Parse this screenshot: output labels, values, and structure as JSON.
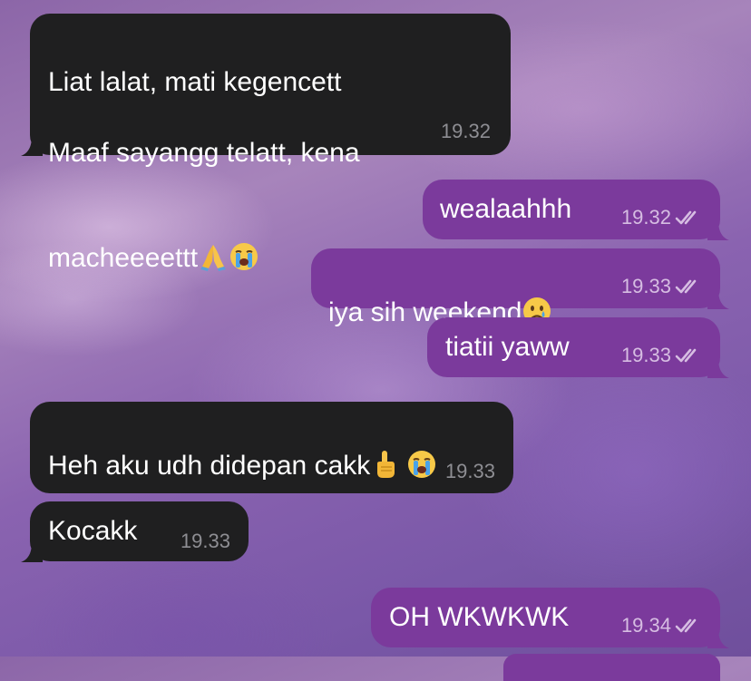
{
  "colors": {
    "incoming_bubble": "#1f1f20",
    "outgoing_bubble": "#7b3a9c",
    "incoming_time": "#8e8e93",
    "outgoing_time": "#d6bde2"
  },
  "messages": [
    {
      "direction": "incoming",
      "lines": [
        "Liat lalat, mati kegencett",
        "Maaf sayangg telatt, kena",
        "macheeeettt"
      ],
      "emojis": [
        "folded-hands",
        "loudly-crying-face"
      ],
      "time": "19.32"
    },
    {
      "direction": "outgoing",
      "text": "wealaahhh",
      "time": "19.32",
      "read": true
    },
    {
      "direction": "outgoing",
      "text": "iya sih weekend",
      "emojis": [
        "crying-face"
      ],
      "time": "19.33",
      "read": true
    },
    {
      "direction": "outgoing",
      "text": "tiatii yaww",
      "time": "19.33",
      "read": true
    },
    {
      "direction": "incoming",
      "text": "Heh aku udh didepan cakk",
      "emojis": [
        "index-pointing-up",
        "loudly-crying-face"
      ],
      "time": "19.33"
    },
    {
      "direction": "incoming",
      "text": "Kocakk",
      "time": "19.33"
    },
    {
      "direction": "outgoing",
      "text": "OH WKWKWK",
      "time": "19.34",
      "read": true
    }
  ]
}
